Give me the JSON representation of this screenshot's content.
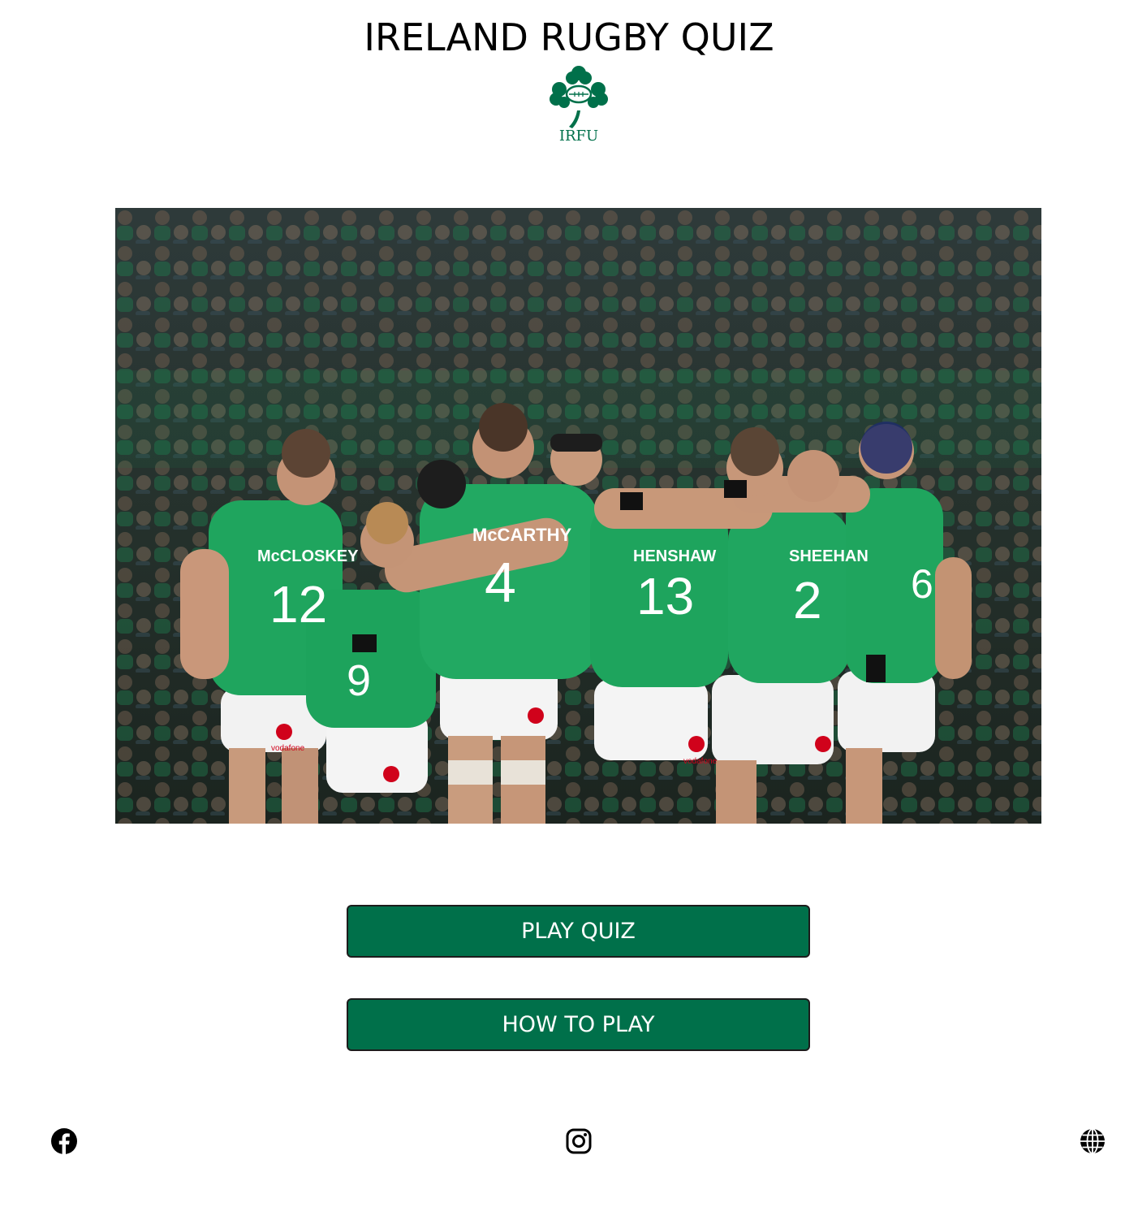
{
  "header": {
    "title": "IRELAND RUGBY QUIZ",
    "logo_text": "IRFU",
    "logo_color": "#00704a"
  },
  "hero_image": {
    "jersey_names": [
      "McCLOSKEY",
      "McCARTHY",
      "HENSHAW",
      "SHEEHAN"
    ],
    "jersey_numbers": [
      "12",
      "4",
      "13",
      "2",
      "9",
      "6"
    ],
    "sponsor": "vodafone",
    "jersey_color": "#1fa55e"
  },
  "buttons": {
    "play_label": "PLAY QUIZ",
    "how_label": "HOW TO PLAY",
    "color": "#00704a"
  },
  "footer": {
    "icons": [
      "facebook-icon",
      "instagram-icon",
      "globe-icon"
    ]
  }
}
